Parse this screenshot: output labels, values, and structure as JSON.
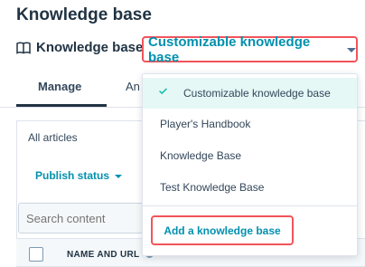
{
  "page": {
    "title": "Knowledge base"
  },
  "kb_selector": {
    "label": "Knowledge base:",
    "selected": "Customizable knowledge base"
  },
  "tabs": [
    {
      "label": "Manage",
      "active": true
    },
    {
      "label": "An"
    }
  ],
  "panel": {
    "all_articles": "All articles",
    "publish_status": "Publish status",
    "search_placeholder": "Search content",
    "column_name": "NAME AND URL"
  },
  "dropdown": {
    "options": [
      {
        "label": "Customizable knowledge base",
        "selected": true
      },
      {
        "label": "Player's Handbook"
      },
      {
        "label": "Knowledge Base"
      },
      {
        "label": "Test Knowledge Base"
      }
    ],
    "add_action": "Add a knowledge base"
  },
  "colors": {
    "accent": "#0091ae",
    "highlight_border": "#f2545b",
    "selected_bg": "#e5f8f6",
    "check": "#00bda5"
  },
  "icons": {
    "kb_label_icon": "book-icon",
    "selected_option_icon": "checkmark-icon",
    "column_info_icon": "info-icon"
  }
}
